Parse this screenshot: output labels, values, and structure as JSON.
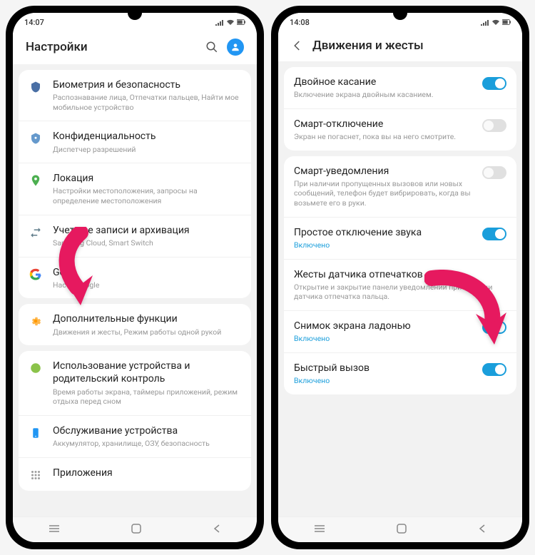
{
  "left": {
    "statusbar": {
      "time": "14:07"
    },
    "header": {
      "title": "Настройки"
    },
    "groups": [
      {
        "items": [
          {
            "icon": "biometrics",
            "title": "Биометрия и безопасность",
            "sub": "Распознавание лица, Отпечатки пальцев, Найти мое мобильное устройство"
          },
          {
            "icon": "privacy",
            "title": "Конфиденциальность",
            "sub": "Диспетчер разрешений"
          },
          {
            "icon": "location",
            "title": "Локация",
            "sub": "Настройки местоположения, запросы на определение местоположения"
          },
          {
            "icon": "accounts",
            "title": "Учетные записи и архивация",
            "sub": "Samsung Cloud, Smart Switch"
          },
          {
            "icon": "google",
            "title": "Goo",
            "sub": "Настр               Google"
          }
        ]
      },
      {
        "items": [
          {
            "icon": "advanced",
            "title": "Дополнительные функции",
            "sub": "Движения и жесты, Режим работы одной рукой"
          }
        ]
      },
      {
        "items": [
          {
            "icon": "wellbeing",
            "title": "Использование устройства и родительский контроль",
            "sub": "Время работы экрана, таймеры приложений, режим отдыха перед сном"
          },
          {
            "icon": "devicecare",
            "title": "Обслуживание устройства",
            "sub": "Аккумулятор, хранилище, ОЗУ, безопасность"
          },
          {
            "icon": "apps",
            "title": "Приложения",
            "sub": ""
          }
        ]
      }
    ]
  },
  "right": {
    "statusbar": {
      "time": "14:08"
    },
    "header": {
      "title": "Движения и жесты"
    },
    "groups": [
      {
        "items": [
          {
            "title": "Двойное касание",
            "sub": "Включение экрана двойным касанием.",
            "toggle": "on"
          },
          {
            "title": "Смарт-отключение",
            "sub": "Экран не погаснет, пока вы на него смотрите.",
            "toggle": "off"
          }
        ]
      },
      {
        "items": [
          {
            "title": "Смарт-уведомления",
            "sub": "При наличии пропущенных вызовов или новых сообщений, телефон будет вибрировать, когда вы возьмете его в руки.",
            "toggle": "off"
          },
          {
            "title": "Простое отключение звука",
            "sub": "Включено",
            "subOn": true,
            "toggle": "on"
          },
          {
            "title": "Жесты датчика отпечатков",
            "sub": "Открытие и закрытие панели уведомлений при помощи датчика отпечатка пальца."
          },
          {
            "title": "Снимок экрана ладонью",
            "sub": "Включено",
            "subOn": true,
            "toggle": "on"
          },
          {
            "title": "Быстрый вызов",
            "sub": "Включено",
            "subOn": true,
            "toggle": "on"
          }
        ]
      }
    ]
  },
  "iconColors": {
    "biometrics": "#4a6fa5",
    "privacy": "#3f7fbf",
    "location": "#4caf50",
    "accounts": "#607d8b",
    "google": "#4285f4",
    "advanced": "#ff9800",
    "wellbeing": "#8bc34a",
    "devicecare": "#2196f3",
    "apps": "#9e9e9e"
  }
}
